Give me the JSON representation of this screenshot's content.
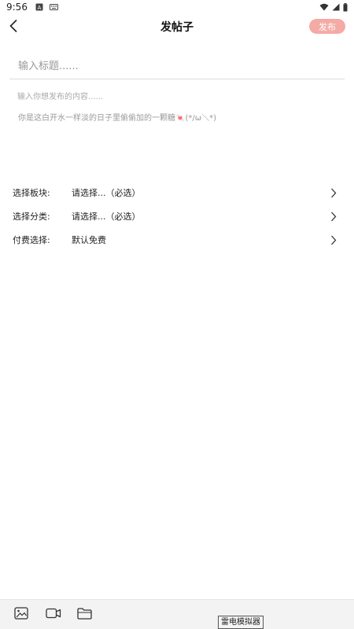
{
  "status_bar": {
    "time": "9:56",
    "icons": [
      "notification-a-icon",
      "keyboard-icon",
      "wifi-icon",
      "signal-icon",
      "battery-icon"
    ]
  },
  "header": {
    "title": "发帖子",
    "publish_label": "发布",
    "back_icon": "chevron-left-icon"
  },
  "form": {
    "title_placeholder": "输入标题......",
    "content_placeholder": "输入你想发布的内容......",
    "hint": "你是这白开水一样淡的日子里偷偷加的一颗糖🍬(*/ω＼*)"
  },
  "options": [
    {
      "label": "选择板块:",
      "value": "请选择...（必选）"
    },
    {
      "label": "选择分类:",
      "value": "请选择...（必选）"
    },
    {
      "label": "付费选择:",
      "value": "默认免费"
    }
  ],
  "toolbar": {
    "icons": [
      "image-icon",
      "video-icon",
      "folder-icon"
    ]
  },
  "emulator_label": "雷电模拟器",
  "colors": {
    "accent": "#f4aaa5",
    "divider": "#dddddd",
    "toolbar_bg": "#f3f3f3"
  }
}
